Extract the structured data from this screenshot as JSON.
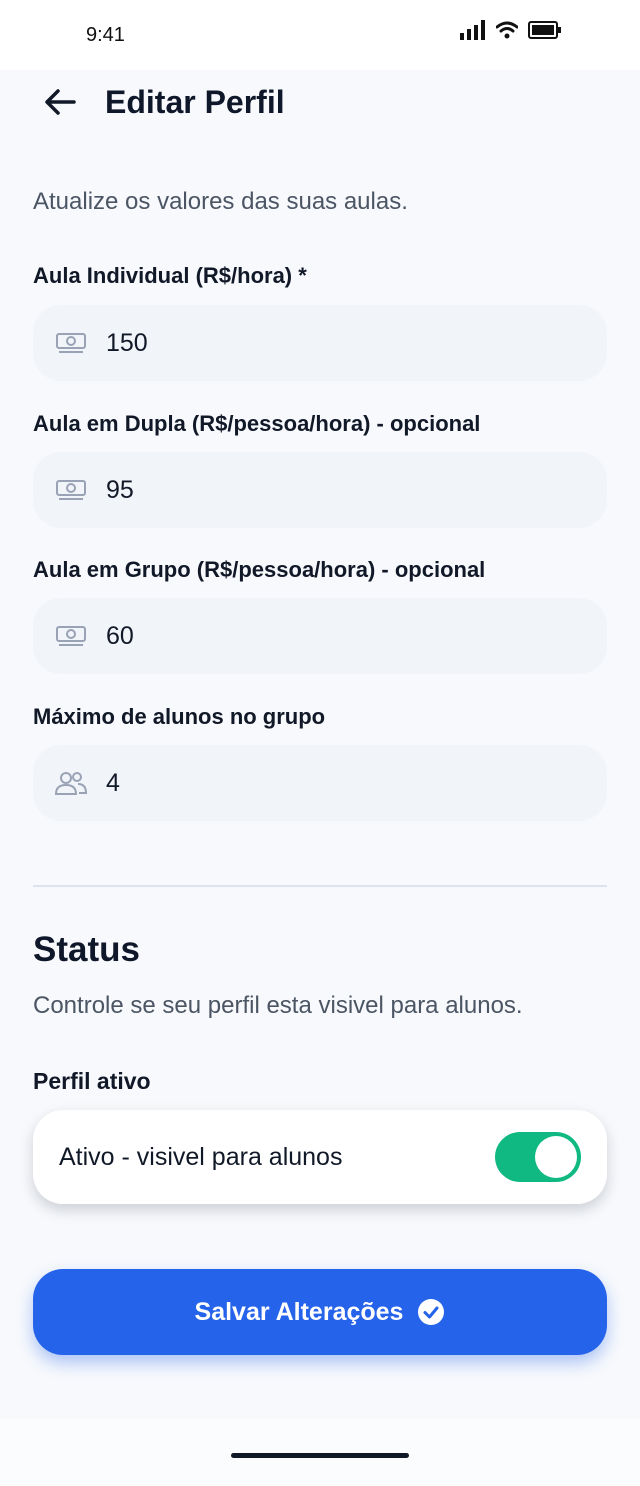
{
  "status_bar": {
    "time": "9:41",
    "icons": [
      "signal-icon",
      "wifi-icon",
      "battery-icon"
    ]
  },
  "header": {
    "back_icon": "arrow-left-icon",
    "title": "Editar Perfil"
  },
  "intro": "Atualize os valores das suas aulas.",
  "fields": [
    {
      "label": "Aula Individual (R$/hora) *",
      "value": "150",
      "icon": "money-icon"
    },
    {
      "label": "Aula em Dupla (R$/pessoa/hora) - opcional",
      "value": "95",
      "icon": "money-icon"
    },
    {
      "label": "Aula em Grupo (R$/pessoa/hora) - opcional",
      "value": "60",
      "icon": "money-icon"
    },
    {
      "label": "Máximo de alunos no grupo",
      "value": "4",
      "icon": "users-icon"
    }
  ],
  "status": {
    "heading": "Status",
    "description": "Controle se seu perfil esta visivel para alunos.",
    "toggle_label": "Perfil ativo",
    "toggle_text": "Ativo - visivel para alunos",
    "toggle_on": true
  },
  "save_button": {
    "label": "Salvar Alterações",
    "icon": "check-circle-icon"
  },
  "colors": {
    "accent": "#2563eb",
    "toggle_on": "#10b981",
    "field_bg": "#f1f4f9",
    "background": "#f7f9fc"
  }
}
